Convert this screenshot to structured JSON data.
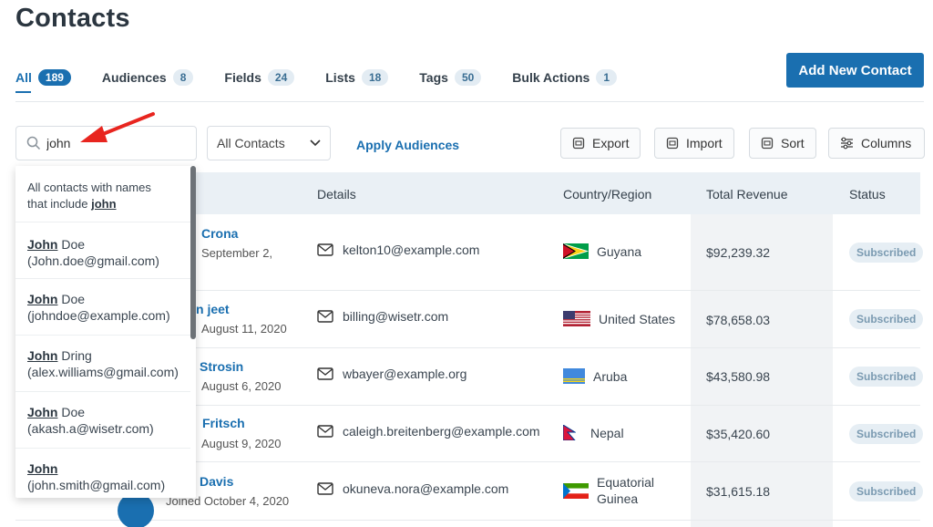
{
  "page_title": "Contacts",
  "tabs": [
    {
      "label": "All",
      "count": "189"
    },
    {
      "label": "Audiences",
      "count": "8"
    },
    {
      "label": "Fields",
      "count": "24"
    },
    {
      "label": "Lists",
      "count": "18"
    },
    {
      "label": "Tags",
      "count": "50"
    },
    {
      "label": "Bulk Actions",
      "count": "1"
    }
  ],
  "add_button": "Add New Contact",
  "search": {
    "value": "john"
  },
  "filter_select": {
    "selected": "All Contacts"
  },
  "apply_link": "Apply Audiences",
  "toolbar": {
    "export": "Export",
    "import": "Import",
    "sort": "Sort",
    "columns": "Columns"
  },
  "table": {
    "headers": {
      "details": "Details",
      "country": "Country/Region",
      "revenue": "Total Revenue",
      "status": "Status"
    },
    "rows": [
      {
        "name": "Crona",
        "joined": "September 2,",
        "email": "kelton10@example.com",
        "country": "Guyana",
        "revenue": "$92,239.32",
        "status": "Subscribed"
      },
      {
        "name": "n jeet",
        "joined": "August 11, 2020",
        "email": "billing@wisetr.com",
        "country": "United States",
        "revenue": "$78,658.03",
        "status": "Subscribed"
      },
      {
        "name": "Strosin",
        "joined": "August 6, 2020",
        "email": "wbayer@example.org",
        "country": "Aruba",
        "revenue": "$43,580.98",
        "status": "Subscribed"
      },
      {
        "name": "Fritsch",
        "joined": "August 9, 2020",
        "email": "caleigh.breitenberg@example.com",
        "country": "Nepal",
        "revenue": "$35,420.60",
        "status": "Subscribed"
      },
      {
        "name": "Davis",
        "joined": "Joined October 4, 2020",
        "email": "okuneva.nora@example.com",
        "country_line1": "Equatorial",
        "country_line2": "Guinea",
        "revenue": "$31,615.18",
        "status": "Subscribed"
      }
    ]
  },
  "dropdown": {
    "summary_line1": "All contacts with names",
    "summary_line2_prefix": "that include ",
    "summary_term": "john",
    "items": [
      {
        "first": "John",
        "last": " Doe",
        "email": "(John.doe@gmail.com)"
      },
      {
        "first": "John",
        "last": " Doe",
        "email": "(johndoe@example.com)"
      },
      {
        "first": "John",
        "last": " Dring",
        "email": "(alex.williams@gmail.com)"
      },
      {
        "first": "John",
        "last": " Doe",
        "email": "(akash.a@wisetr.com)"
      },
      {
        "first": "John",
        "last": "",
        "email": "(john.smith@gmail.com)"
      }
    ]
  },
  "colors": {
    "accent": "#1a6fb0",
    "arrow": "#e8251f"
  }
}
